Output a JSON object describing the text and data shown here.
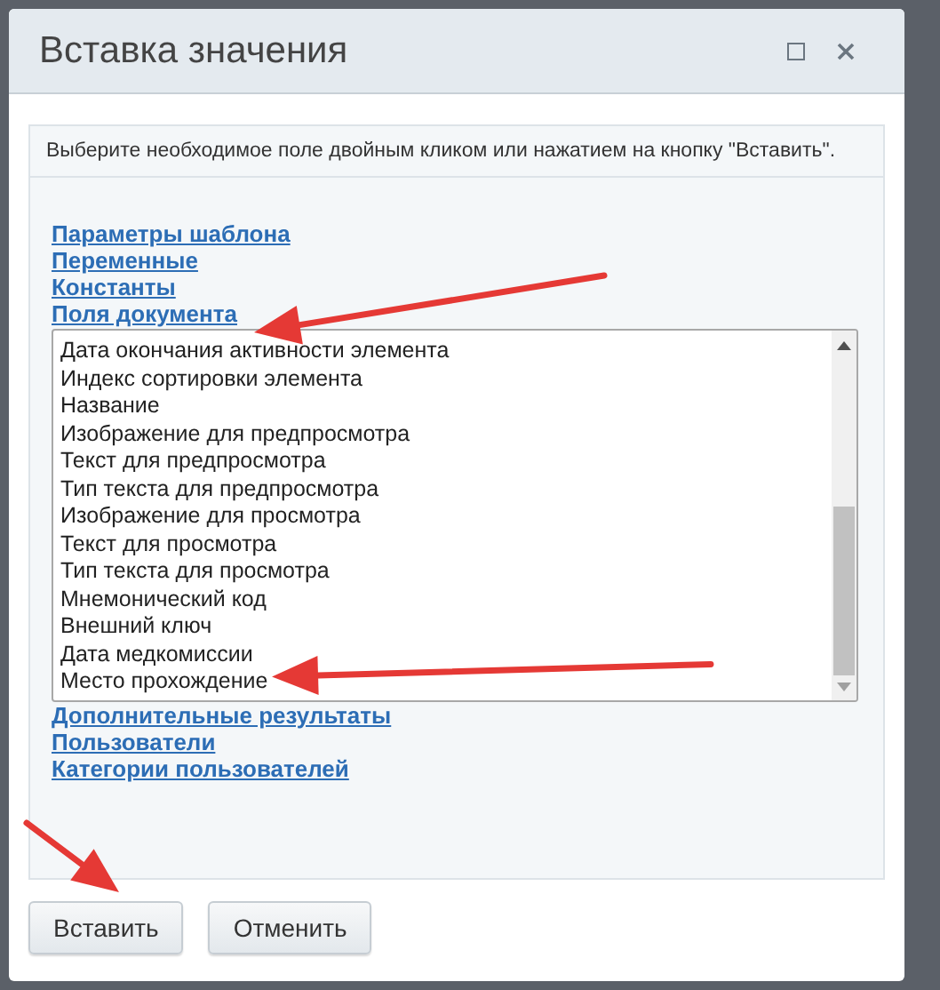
{
  "window": {
    "title": "Вставка значения"
  },
  "instruction": "Выберите необходимое поле двойным кликом или нажатием на кнопку \"Вставить\".",
  "groups_before": [
    "Параметры шаблона",
    "Переменные",
    "Константы",
    "Поля документа"
  ],
  "fields_list": {
    "items": [
      {
        "label": "Дата окончания активности элемента",
        "selected": false
      },
      {
        "label": "Индекс сортировки элемента",
        "selected": false
      },
      {
        "label": "Название",
        "selected": false
      },
      {
        "label": "Изображение для предпросмотра",
        "selected": false
      },
      {
        "label": "Текст для предпросмотра",
        "selected": false
      },
      {
        "label": "Тип текста для предпросмотра",
        "selected": false
      },
      {
        "label": "Изображение для просмотра",
        "selected": false
      },
      {
        "label": "Текст для просмотра",
        "selected": false
      },
      {
        "label": "Тип текста для просмотра",
        "selected": false
      },
      {
        "label": "Мнемонический код",
        "selected": false
      },
      {
        "label": "Внешний ключ",
        "selected": false
      },
      {
        "label": "Дата медкомиссии",
        "selected": false
      },
      {
        "label": "Место прохождение",
        "selected": false
      }
    ]
  },
  "groups_after": [
    "Дополнительные результаты",
    "Пользователи",
    "Категории пользователей"
  ],
  "buttons": [
    "Вставить",
    "Отменить"
  ]
}
